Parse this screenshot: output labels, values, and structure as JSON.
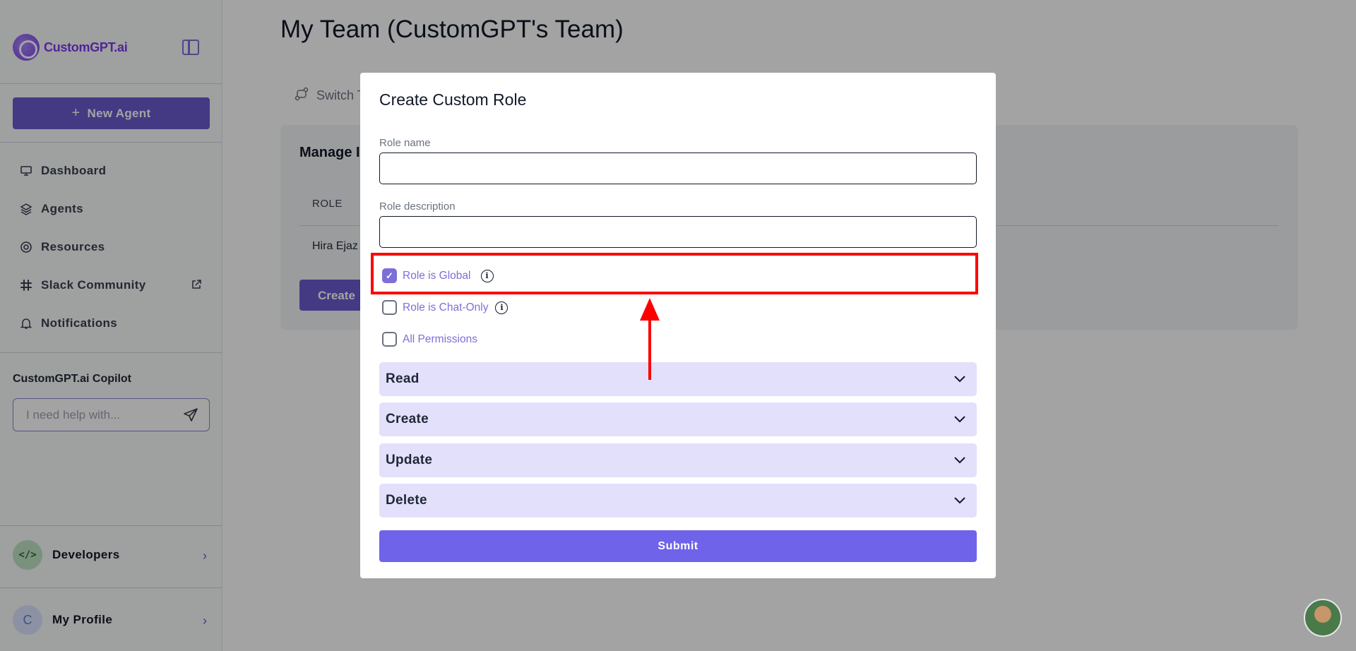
{
  "sidebar": {
    "brand": "CustomGPT.ai",
    "new_agent_label": "New Agent",
    "nav": [
      {
        "label": "Dashboard",
        "icon": "monitor-icon"
      },
      {
        "label": "Agents",
        "icon": "layers-icon"
      },
      {
        "label": "Resources",
        "icon": "lifebuoy-icon"
      },
      {
        "label": "Slack Community",
        "icon": "slack-icon"
      },
      {
        "label": "Notifications",
        "icon": "bell-icon"
      }
    ],
    "copilot": {
      "title": "CustomGPT.ai Copilot",
      "placeholder": "I need help with..."
    },
    "developers_label": "Developers",
    "profile_label": "My Profile",
    "profile_initial": "C"
  },
  "main": {
    "page_title": "My Team (CustomGPT's Team)",
    "switch_label": "Switch T",
    "manage_title": "Manage I",
    "role_header": "ROLE",
    "role_cell": "Hira Ejaz",
    "create_label": "Create"
  },
  "modal": {
    "title": "Create Custom Role",
    "role_name_label": "Role name",
    "role_name_value": "",
    "role_description_label": "Role description",
    "role_description_value": "",
    "checkboxes": [
      {
        "label": "Role is Global",
        "checked": true,
        "info": true
      },
      {
        "label": "Role is Chat-Only",
        "checked": false,
        "info": true
      },
      {
        "label": "All Permissions",
        "checked": false,
        "info": false
      }
    ],
    "sections": [
      "Read",
      "Create",
      "Update",
      "Delete"
    ],
    "submit_label": "Submit"
  },
  "colors": {
    "accent": "#6a5ccd",
    "submit": "#6f63ea",
    "accordion": "#e3e0fb",
    "annotation": "#ff0000"
  }
}
